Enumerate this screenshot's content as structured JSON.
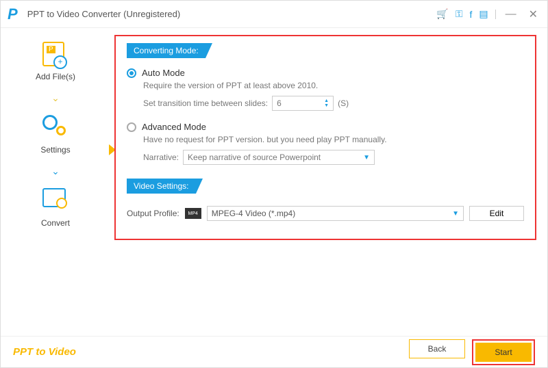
{
  "titlebar": {
    "logo": "P",
    "title": "PPT to Video Converter (Unregistered)"
  },
  "sidebar": {
    "add": "Add File(s)",
    "settings": "Settings",
    "convert": "Convert"
  },
  "sections": {
    "converting": "Converting Mode:",
    "video": "Video Settings:"
  },
  "auto": {
    "title": "Auto Mode",
    "desc": "Require the version of PPT at least above 2010.",
    "transition_label": "Set transition time between slides:",
    "transition_value": "6",
    "unit": "(S)"
  },
  "advanced": {
    "title": "Advanced Mode",
    "desc": "Have no request for PPT version. but you need play PPT manually.",
    "narrative_label": "Narrative:",
    "narrative_value": "Keep narrative of source Powerpoint"
  },
  "output": {
    "label": "Output Profile:",
    "value": "MPEG-4 Video (*.mp4)",
    "edit": "Edit"
  },
  "footer": {
    "brand": "PPT to Video",
    "back": "Back",
    "start": "Start"
  }
}
